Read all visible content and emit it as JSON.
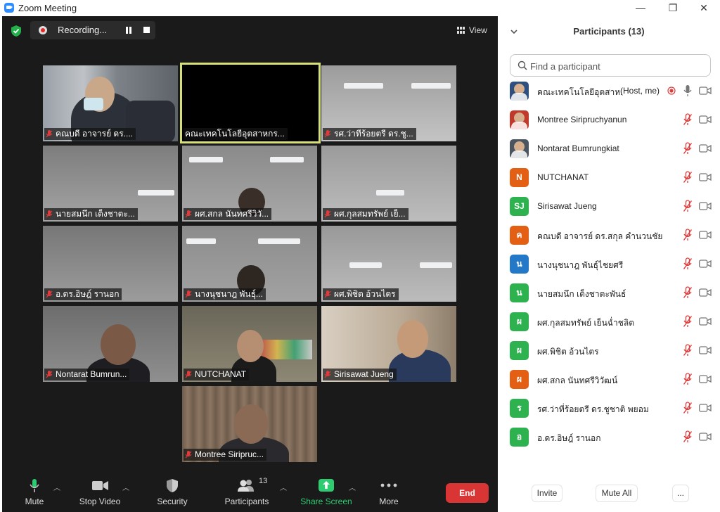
{
  "window": {
    "title": "Zoom Meeting",
    "controls": {
      "minimize": "—",
      "maximize": "❐",
      "close": "✕"
    }
  },
  "meeting": {
    "recording_label": "Recording...",
    "view_label": "View",
    "tiles": [
      {
        "name": "คณบดี อาจารย์ ดร....",
        "muted": true,
        "active": false
      },
      {
        "name": "คณะเทคโนโลยีอุตสาหกร...",
        "muted": false,
        "active": true
      },
      {
        "name": "รศ.ว่าที่ร้อยตรี ดร.ชู...",
        "muted": true,
        "active": false
      },
      {
        "name": "นายสมนึก  เต็งชาตะ...",
        "muted": true,
        "active": false
      },
      {
        "name": "ผศ.สกล  นันทศรีวิวั...",
        "muted": true,
        "active": false
      },
      {
        "name": "ผศ.กุลสมทรัพย์  เย็...",
        "muted": true,
        "active": false
      },
      {
        "name": "อ.ดร.อิษฎ์  รานอก",
        "muted": true,
        "active": false
      },
      {
        "name": "นางนุชนาฎ  พันธุ์...",
        "muted": true,
        "active": false
      },
      {
        "name": "ผศ.พิชิต  อ้วนไตร",
        "muted": true,
        "active": false
      },
      {
        "name": "Nontarat Bumrun...",
        "muted": true,
        "active": false
      },
      {
        "name": "NUTCHANAT",
        "muted": true,
        "active": false
      },
      {
        "name": "Sirisawat Jueng",
        "muted": true,
        "active": false
      },
      {
        "name": "Montree Siripruc...",
        "muted": true,
        "active": false
      }
    ]
  },
  "toolbar": {
    "mute_label": "Mute",
    "stop_video_label": "Stop Video",
    "security_label": "Security",
    "participants_label": "Participants",
    "participants_count": "13",
    "share_label": "Share Screen",
    "more_label": "More",
    "end_label": "End",
    "share_color": "#2ecc71",
    "end_color": "#d93535"
  },
  "panel": {
    "title": "Participants (13)",
    "search_placeholder": "Find a participant",
    "participants": [
      {
        "name": "คณะเทคโนโลยีอุตสาห...",
        "role": "(Host, me)",
        "avatar": "",
        "avatar_color": "#2f4f7f",
        "photo": true,
        "muted": false,
        "recording": true
      },
      {
        "name": "Montree Siripruchyanun",
        "avatar": "",
        "avatar_color": "#c0392b",
        "photo": true,
        "muted": true
      },
      {
        "name": "Nontarat Bumrungkiat",
        "avatar": "",
        "avatar_color": "#4a5560",
        "photo": true,
        "muted": true
      },
      {
        "name": "NUTCHANAT",
        "avatar": "N",
        "avatar_color": "#e35f14",
        "muted": true
      },
      {
        "name": "Sirisawat Jueng",
        "avatar": "SJ",
        "avatar_color": "#2eb24f",
        "muted": true
      },
      {
        "name": "คณบดี อาจารย์ ดร.สกุล คำนวนชัย",
        "avatar": "ค",
        "avatar_color": "#e35f14",
        "muted": true
      },
      {
        "name": "นางนุชนาฎ  พันธุ์ไชยศรี",
        "avatar": "น",
        "avatar_color": "#2478c8",
        "muted": true
      },
      {
        "name": "นายสมนึก  เต็งชาตะพันธ์",
        "avatar": "น",
        "avatar_color": "#2eb24f",
        "muted": true
      },
      {
        "name": "ผศ.กุลสมทรัพย์  เย็นฉ่ำชลิต",
        "avatar": "ผ",
        "avatar_color": "#2eb24f",
        "muted": true
      },
      {
        "name": "ผศ.พิชิต  อ้วนไตร",
        "avatar": "ผ",
        "avatar_color": "#2eb24f",
        "muted": true
      },
      {
        "name": "ผศ.สกล  นันทศรีวิวัฒน์",
        "avatar": "ผ",
        "avatar_color": "#e35f14",
        "muted": true
      },
      {
        "name": "รศ.ว่าที่ร้อยตรี ดร.ชูชาติ  พยอม",
        "avatar": "ร",
        "avatar_color": "#2eb24f",
        "muted": true
      },
      {
        "name": "อ.ดร.อิษฎ์  รานอก",
        "avatar": "อ",
        "avatar_color": "#2eb24f",
        "muted": true
      }
    ],
    "invite_label": "Invite",
    "mute_all_label": "Mute All",
    "more_label": "..."
  }
}
